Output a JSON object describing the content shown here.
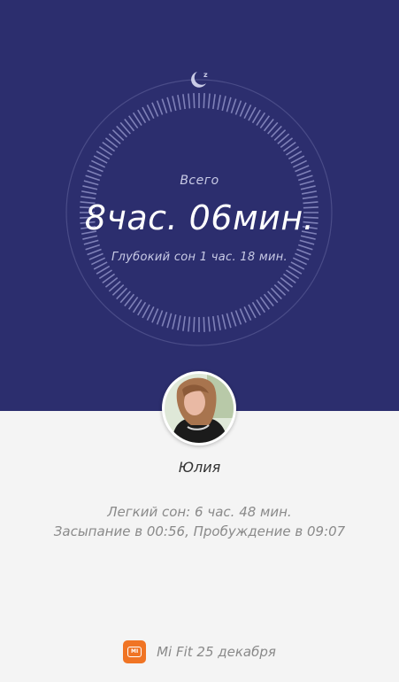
{
  "sleep_summary": {
    "total_label": "Всего",
    "total_duration": "8час. 06мин.",
    "deep_sleep": "Глубокий сон 1 час. 18 мин."
  },
  "user": {
    "name": "Юлия"
  },
  "details": {
    "light_sleep": "Легкий сон: 6 час. 48 мин.",
    "sleep_times": "Засыпание в 00:56, Пробуждение в 09:07"
  },
  "footer": {
    "logo_text": "MI",
    "source": "Mi Fit 25 декабря"
  },
  "colors": {
    "top_background": "#2c2e6e",
    "bottom_background": "#f4f4f4",
    "accent_orange": "#f07424"
  },
  "icons": {
    "sleep": "moon-zz-icon",
    "app": "mi-logo-icon"
  }
}
